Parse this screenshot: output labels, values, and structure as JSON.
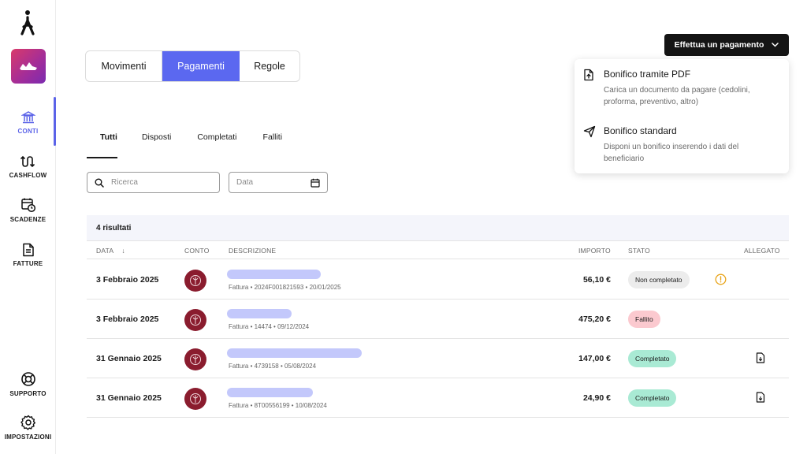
{
  "sidebar": {
    "items": [
      {
        "label": "CONTI",
        "icon": "bank-icon",
        "active": true
      },
      {
        "label": "CASHFLOW",
        "icon": "cashflow-icon",
        "active": false
      },
      {
        "label": "SCADENZE",
        "icon": "calendar-clock-icon",
        "active": false
      },
      {
        "label": "FATTURE",
        "icon": "document-icon",
        "active": false
      },
      {
        "label": "SUPPORTO",
        "icon": "lifebuoy-icon",
        "active": false
      },
      {
        "label": "IMPOSTAZIONI",
        "icon": "gear-icon",
        "active": false
      }
    ]
  },
  "segmented": {
    "options": [
      "Movimenti",
      "Pagamenti",
      "Regole"
    ],
    "selected": "Pagamenti"
  },
  "subtabs": {
    "items": [
      "Tutti",
      "Disposti",
      "Completati",
      "Falliti"
    ],
    "selected": "Tutti"
  },
  "filters": {
    "search_placeholder": "Ricerca",
    "date_placeholder": "Data"
  },
  "table": {
    "count_label": "4 risultati",
    "headers": {
      "date": "DATA",
      "account": "CONTO",
      "description": "DESCRIZIONE",
      "amount": "IMPORTO",
      "status": "STATO",
      "attachment": "ALLEGATO"
    },
    "rows": [
      {
        "date": "3 Febbraio 2025",
        "subtitle": "Fattura • 2024F001821593 • 20/01/2025",
        "amount": "56,10 €",
        "status": "Non completato",
        "status_kind": "grey",
        "warning": true,
        "attachment": false
      },
      {
        "date": "3 Febbraio 2025",
        "subtitle": "Fattura • 14474 • 09/12/2024",
        "amount": "475,20 €",
        "status": "Fallito",
        "status_kind": "red",
        "warning": false,
        "attachment": false
      },
      {
        "date": "31 Gennaio 2025",
        "subtitle": "Fattura • 4739158 • 05/08/2024",
        "amount": "147,00 €",
        "status": "Completato",
        "status_kind": "green",
        "warning": false,
        "attachment": true
      },
      {
        "date": "31 Gennaio 2025",
        "subtitle": "Fattura • 8T00556199 • 10/08/2024",
        "amount": "24,90 €",
        "status": "Completato",
        "status_kind": "green",
        "warning": false,
        "attachment": true
      }
    ]
  },
  "pay_button": {
    "label": "Effettua un pagamento",
    "icon": "chevron-down-icon"
  },
  "dropdown": {
    "items": [
      {
        "title": "Bonifico tramite PDF",
        "description": "Carica un documento da pagare (cedolini, proforma, preventivo, altro)",
        "icon": "file-upload-icon"
      },
      {
        "title": "Bonifico standard",
        "description": "Disponi un bonifico inserendo i dati del beneficiario",
        "icon": "send-icon"
      }
    ]
  },
  "colors": {
    "accent": "#5b68f0",
    "status_grey": "#ececec",
    "status_red": "#fbc9cf",
    "status_green": "#a9ead4",
    "warning": "#e8a317",
    "bank_logo": "#8a1c2e"
  }
}
